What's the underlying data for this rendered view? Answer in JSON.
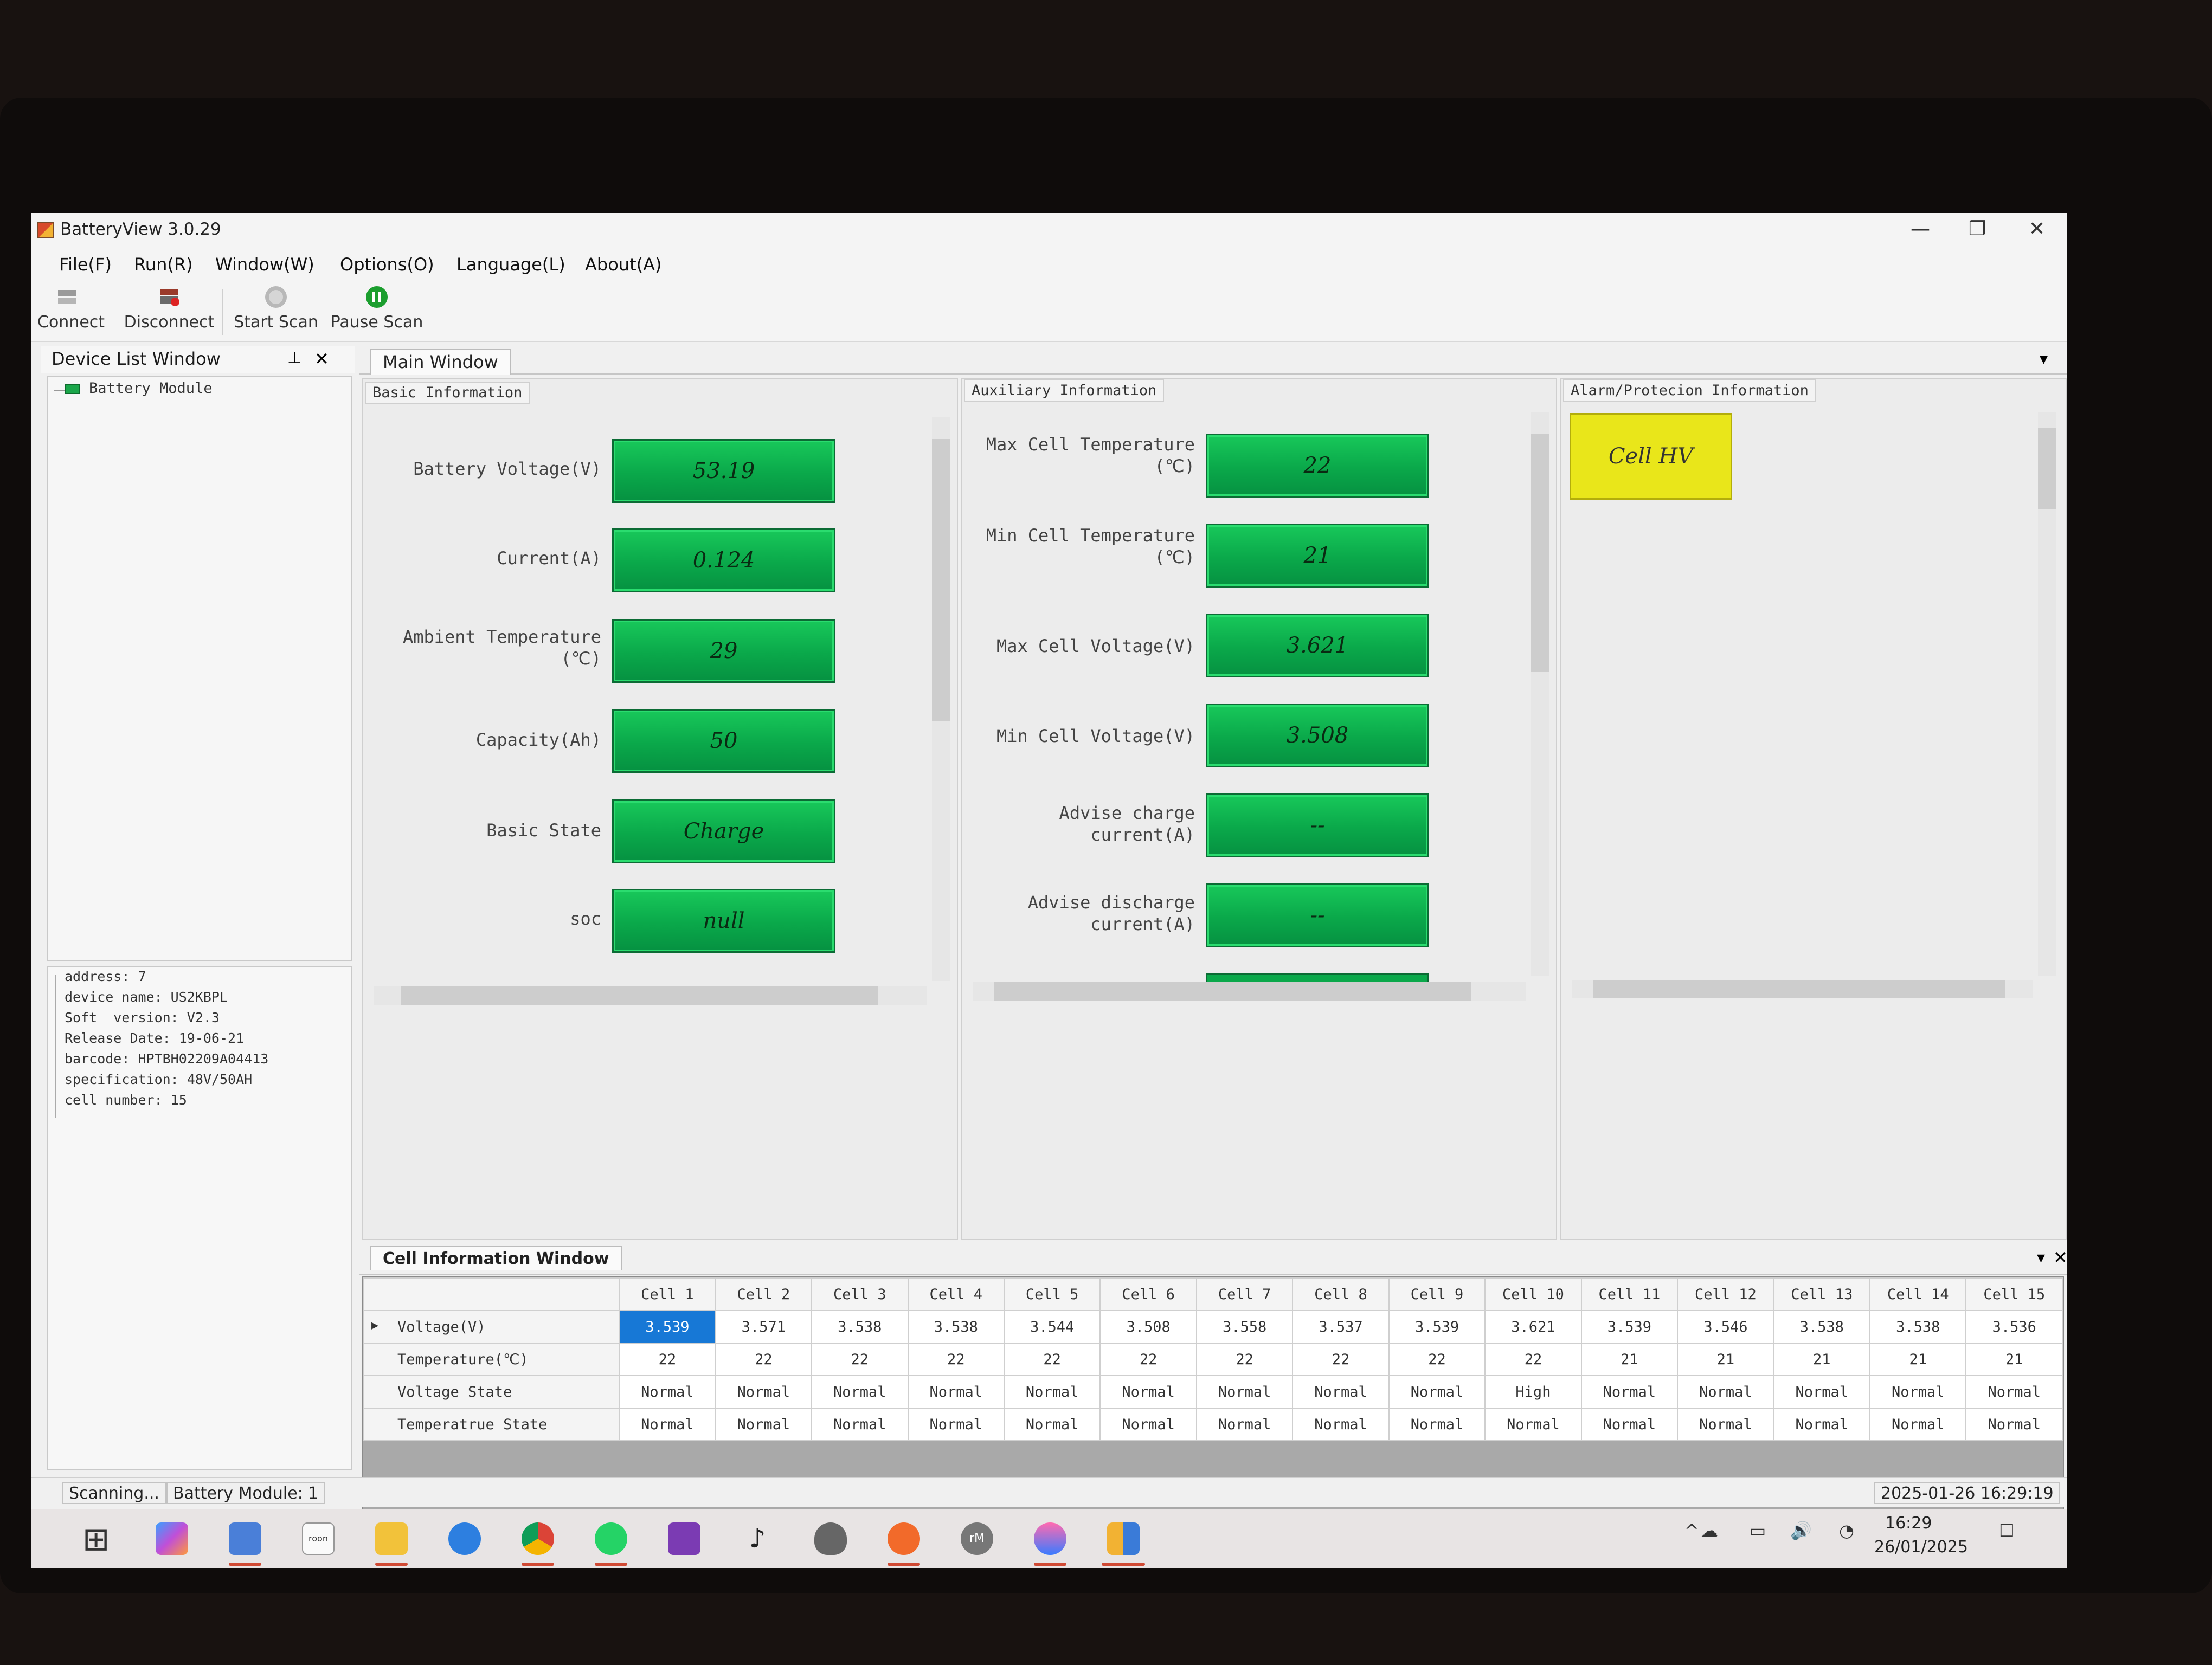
{
  "window": {
    "title": "BatteryView 3.0.29",
    "controls": {
      "minimize": "—",
      "restore": "❐",
      "close": "✕"
    }
  },
  "menu": [
    "File(F)",
    "Run(R)",
    "Window(W)",
    "Options(O)",
    "Language(L)",
    "About(A)"
  ],
  "toolbar": {
    "connect": "Connect",
    "disconnect": "Disconnect",
    "start_scan": "Start Scan",
    "pause_scan": "Pause Scan"
  },
  "device_list": {
    "title": "Device List Window",
    "pin": "⊥",
    "close": "✕",
    "tree_item": "Battery Module",
    "properties": [
      "address: 7",
      "device name: US2KBPL",
      "Soft  version: V2.3",
      "Release Date: 19-06-21",
      "barcode: HPTBH02209A04413",
      "specification: 48V/50AH",
      "cell number: 15"
    ]
  },
  "main_window": {
    "tab": "Main Window",
    "dropdown": "▾",
    "basic": {
      "title": "Basic Information",
      "fields": [
        {
          "label": "Battery Voltage(V)",
          "value": "53.19"
        },
        {
          "label": "Current(A)",
          "value": "0.124"
        },
        {
          "label": "Ambient Temperature\n(℃)",
          "value": "29"
        },
        {
          "label": "Capacity(Ah)",
          "value": "50"
        },
        {
          "label": "Basic State",
          "value": "Charge"
        },
        {
          "label": "soc",
          "value": "null"
        }
      ]
    },
    "auxiliary": {
      "title": "Auxiliary Information",
      "fields": [
        {
          "label": "Max Cell Temperature\n(℃)",
          "value": "22"
        },
        {
          "label": "Min Cell Temperature\n(℃)",
          "value": "21"
        },
        {
          "label": "Max Cell Voltage(V)",
          "value": "3.621"
        },
        {
          "label": "Min Cell Voltage(V)",
          "value": "3.508"
        },
        {
          "label": "Advise charge\ncurrent(A)",
          "value": "--"
        },
        {
          "label": "Advise discharge\ncurrent(A)",
          "value": "--"
        }
      ]
    },
    "alarm": {
      "title": "Alarm/Protecion Information",
      "items": [
        "Cell HV"
      ]
    }
  },
  "cell_window": {
    "tab": "Cell Information Window",
    "dropdown": "▾",
    "close": "✕",
    "columns": [
      "Cell 1",
      "Cell 2",
      "Cell 3",
      "Cell 4",
      "Cell 5",
      "Cell 6",
      "Cell 7",
      "Cell 8",
      "Cell 9",
      "Cell 10",
      "Cell 11",
      "Cell 12",
      "Cell 13",
      "Cell 14",
      "Cell 15"
    ],
    "rows": [
      {
        "label": "Voltage(V)",
        "values": [
          "3.539",
          "3.571",
          "3.538",
          "3.538",
          "3.544",
          "3.508",
          "3.558",
          "3.537",
          "3.539",
          "3.621",
          "3.539",
          "3.546",
          "3.538",
          "3.538",
          "3.536"
        ]
      },
      {
        "label": "Temperature(℃)",
        "values": [
          "22",
          "22",
          "22",
          "22",
          "22",
          "22",
          "22",
          "22",
          "22",
          "22",
          "21",
          "21",
          "21",
          "21",
          "21"
        ]
      },
      {
        "label": "Voltage State",
        "values": [
          "Normal",
          "Normal",
          "Normal",
          "Normal",
          "Normal",
          "Normal",
          "Normal",
          "Normal",
          "Normal",
          "High",
          "Normal",
          "Normal",
          "Normal",
          "Normal",
          "Normal"
        ]
      },
      {
        "label": "Temperatrue State",
        "values": [
          "Normal",
          "Normal",
          "Normal",
          "Normal",
          "Normal",
          "Normal",
          "Normal",
          "Normal",
          "Normal",
          "Normal",
          "Normal",
          "Normal",
          "Normal",
          "Normal",
          "Normal"
        ]
      }
    ],
    "row_pointer": "▶"
  },
  "status": {
    "scanning": "Scanning...",
    "module": "Battery Module: 1",
    "datetime": "2025-01-26 16:29:19"
  },
  "taskbar": {
    "start": "⊞",
    "roon_label": "roon",
    "rm_label": "rM",
    "clock_time": "16:29",
    "clock_date": "26/01/2025",
    "icons": [
      "windows-start-icon",
      "copilot-icon",
      "network-app-icon",
      "roon-icon",
      "file-explorer-icon",
      "settings-icon",
      "chrome-icon",
      "whatsapp-icon",
      "onenote-icon",
      "music-icon",
      "fox-app-icon",
      "mail-icon",
      "remarkable-icon",
      "drop-app-icon",
      "batteryview-icon"
    ],
    "tray": {
      "chevron": "^",
      "cloud": "☁",
      "battery": "▭",
      "volume": "🔊",
      "wifi": "◔",
      "notifications": "☐"
    }
  }
}
